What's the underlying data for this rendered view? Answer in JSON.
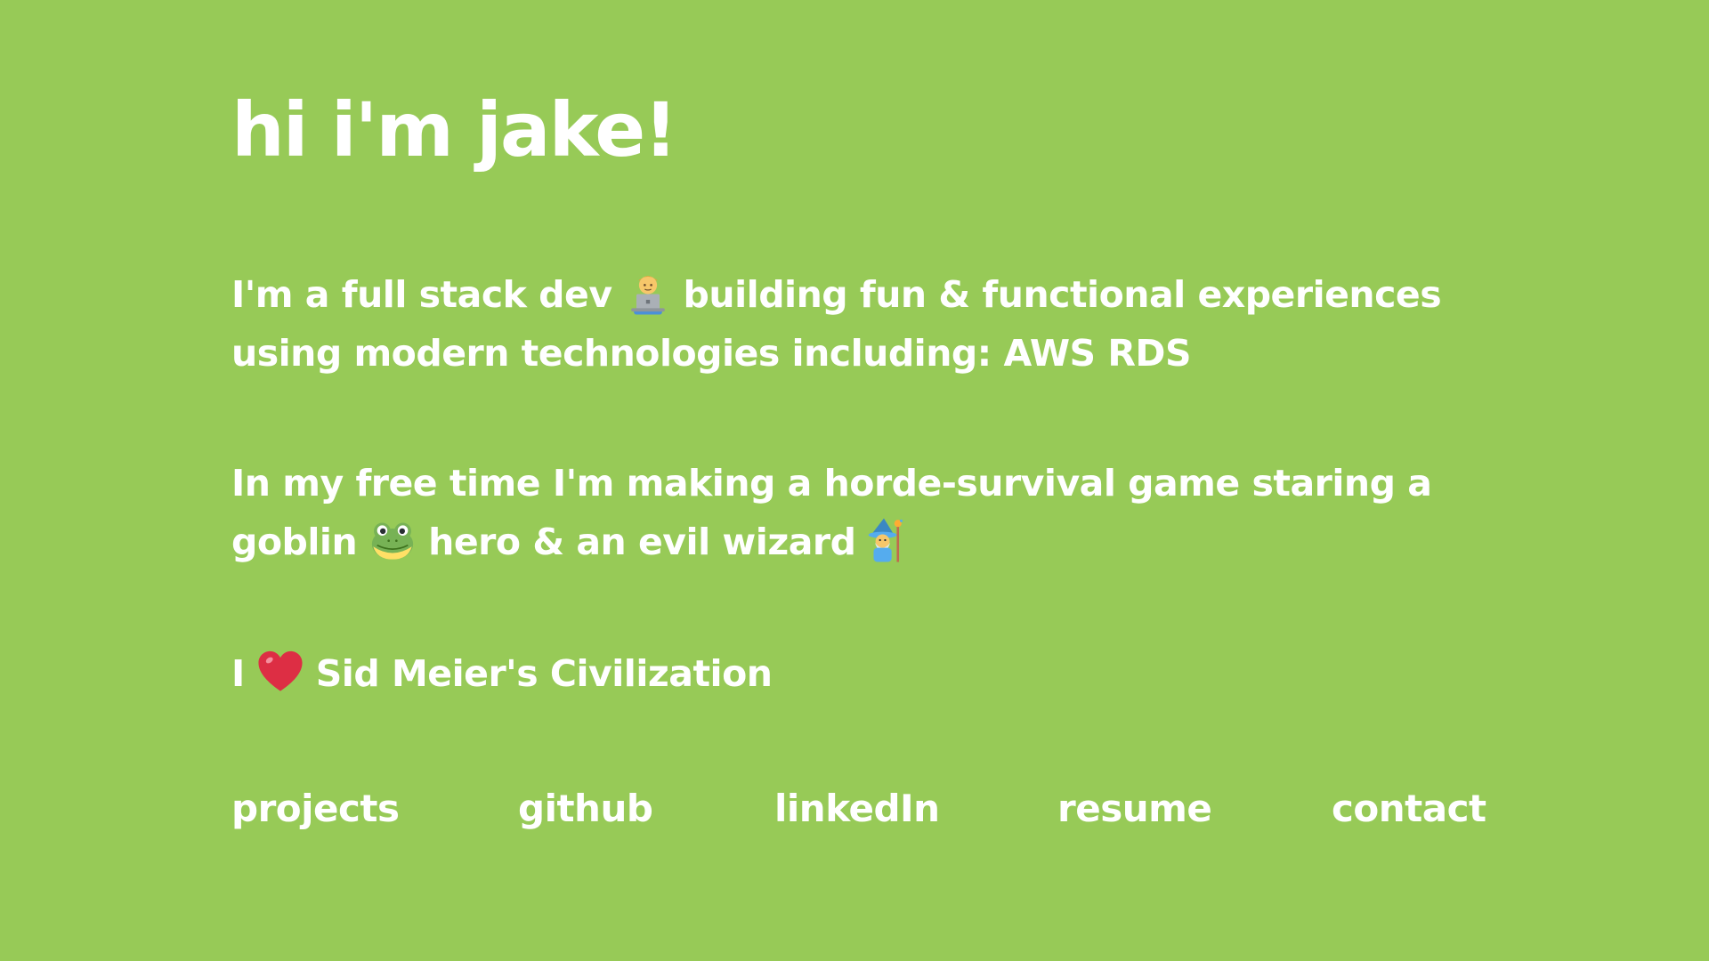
{
  "page": {
    "background_color": "#97CA57",
    "text_color": "#FFFFFF"
  },
  "headline": "hi i'm jake!",
  "intro": {
    "part1": "I'm a full stack dev",
    "emoji1": "technologist-icon",
    "part2": "building fun & functional experiences using modern technologies including: AWS RDS"
  },
  "hobby": {
    "part1": "In my free time I'm making a horde-survival game staring a goblin",
    "emoji1": "frog-icon",
    "part2": "hero & an evil wizard",
    "emoji2": "wizard-icon"
  },
  "love": {
    "part1": "I",
    "emoji1": "heart-icon",
    "part2": "Sid Meier's Civilization"
  },
  "nav": {
    "projects": "projects",
    "github": "github",
    "linkedin": "linkedIn",
    "resume": "resume",
    "contact": "contact"
  }
}
